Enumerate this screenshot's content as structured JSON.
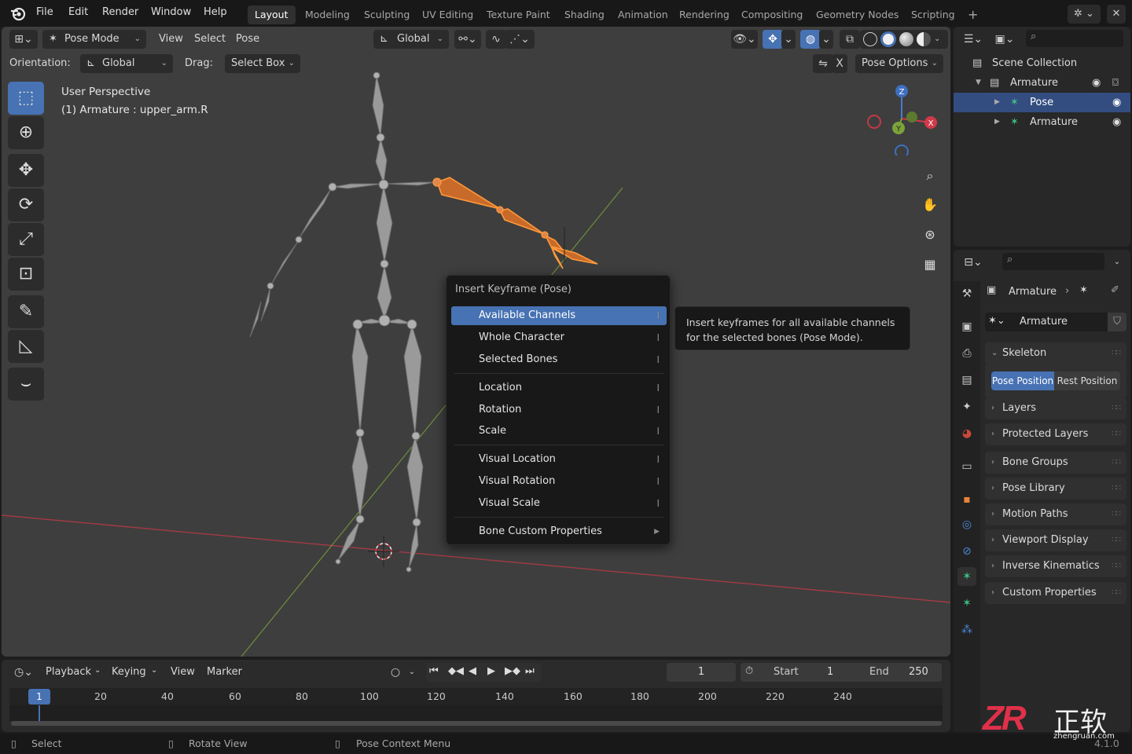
{
  "topbar": {
    "menus": [
      "File",
      "Edit",
      "Render",
      "Window",
      "Help"
    ],
    "workspaces": [
      "Layout",
      "Modeling",
      "Sculpting",
      "UV Editing",
      "Texture Paint",
      "Shading",
      "Animation",
      "Rendering",
      "Compositing",
      "Geometry Nodes",
      "Scripting"
    ],
    "active_workspace": "Layout",
    "add_tab": "+"
  },
  "viewport_header": {
    "mode": "Pose Mode",
    "menus": [
      "View",
      "Select",
      "Pose"
    ],
    "transform_orientation": "Global"
  },
  "viewport_header2": {
    "orientation_label": "Orientation:",
    "orientation_value": "Global",
    "drag_label": "Drag:",
    "drag_value": "Select Box",
    "mirror_x": "X",
    "pose_options": "Pose Options"
  },
  "viewport_info": {
    "perspective": "User Perspective",
    "object": "(1) Armature : upper_arm.R"
  },
  "gizmo": {
    "z": "Z",
    "y": "Y",
    "x": "X"
  },
  "context_menu": {
    "title": "Insert Keyframe (Pose)",
    "items": [
      {
        "label": "Available Channels",
        "shortcut": "I"
      },
      {
        "label": "Whole Character",
        "shortcut": "I"
      },
      {
        "label": "Selected Bones",
        "shortcut": "I"
      },
      {
        "label": "Location",
        "shortcut": "I"
      },
      {
        "label": "Rotation",
        "shortcut": "I"
      },
      {
        "label": "Scale",
        "shortcut": "I"
      },
      {
        "label": "Visual Location",
        "shortcut": "I"
      },
      {
        "label": "Visual Rotation",
        "shortcut": "I"
      },
      {
        "label": "Visual Scale",
        "shortcut": "I"
      },
      {
        "label": "Bone Custom Properties",
        "shortcut": "▶"
      }
    ],
    "selected_item": "Available Channels"
  },
  "tooltip": {
    "line1": "Insert keyframes for all available channels",
    "line2": "for the selected bones (Pose Mode)."
  },
  "timeline": {
    "menus": [
      "Playback",
      "Keying",
      "View",
      "Marker"
    ],
    "current_frame": "1",
    "start_label": "Start",
    "start_value": "1",
    "end_label": "End",
    "end_value": "250",
    "ruler_ticks": [
      "20",
      "40",
      "60",
      "80",
      "100",
      "120",
      "140",
      "160",
      "180",
      "200",
      "220",
      "240"
    ],
    "playhead": "1"
  },
  "statusbar": {
    "select": "Select",
    "rotate": "Rotate View",
    "context": "Pose Context Menu",
    "version": "4.1.0"
  },
  "outliner": {
    "root": "Scene Collection",
    "rows": [
      {
        "label": "Armature"
      },
      {
        "label": "Pose"
      },
      {
        "label": "Armature"
      }
    ]
  },
  "properties": {
    "breadcrumb_object": "Armature",
    "data_name": "Armature",
    "skeleton_panel": "Skeleton",
    "pose_position": "Pose Position",
    "rest_position": "Rest Position",
    "panels": [
      "Layers",
      "Protected Layers",
      "Bone Groups",
      "Pose Library",
      "Motion Paths",
      "Viewport Display",
      "Inverse Kinematics",
      "Custom Properties"
    ]
  },
  "watermark": {
    "logo": "ZR",
    "cn": "正软",
    "url": "zhengruan.com"
  },
  "colors": {
    "accent": "#4772b3",
    "selected_bone": "#f0822a",
    "bone": "#9a9a9a",
    "viewport_bg": "#3e3e3e",
    "axis_x": "#b53a46",
    "axis_y": "#7ca33a"
  }
}
